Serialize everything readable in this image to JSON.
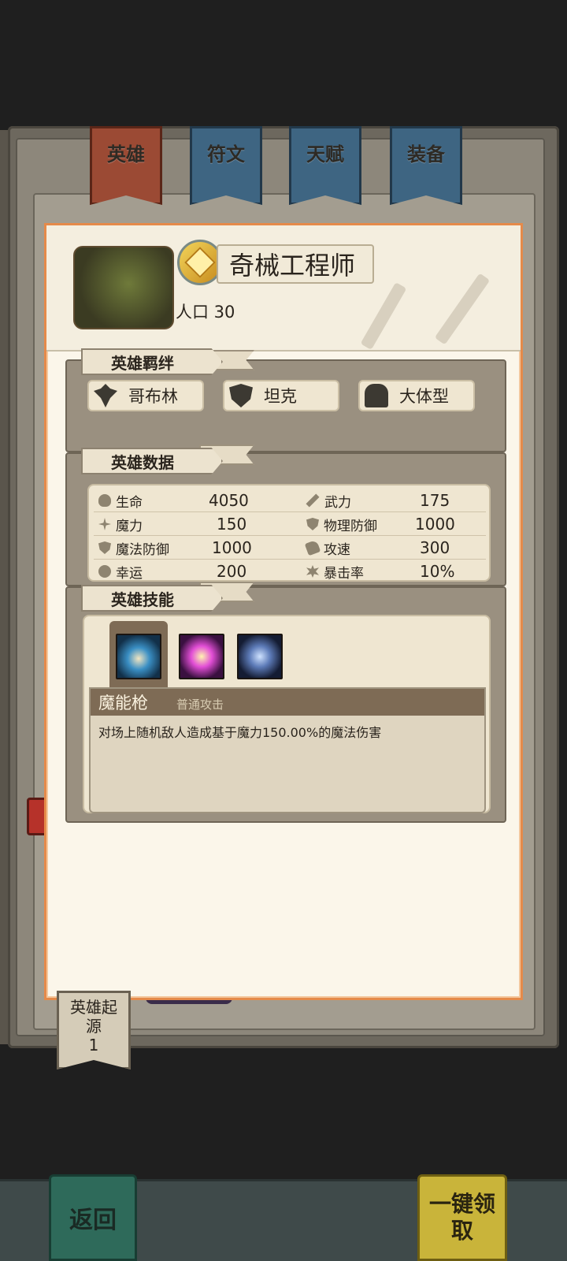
{
  "tabs": [
    {
      "label": "英雄",
      "active": true
    },
    {
      "label": "符文",
      "active": false
    },
    {
      "label": "天赋",
      "active": false
    },
    {
      "label": "装备",
      "active": false
    }
  ],
  "hero": {
    "name": "奇械工程师",
    "population": "人口 30"
  },
  "sections": {
    "bonds_title": "英雄羁绊",
    "stats_title": "英雄数据",
    "skills_title": "英雄技能"
  },
  "bonds": [
    {
      "label": "哥布林",
      "icon": "goblin-icon"
    },
    {
      "label": "坦克",
      "icon": "shield-icon"
    },
    {
      "label": "大体型",
      "icon": "body-icon"
    }
  ],
  "stats": [
    {
      "label": "生命",
      "value": "4050",
      "icon": "heart-icon"
    },
    {
      "label": "武力",
      "value": "175",
      "icon": "sword-icon"
    },
    {
      "label": "魔力",
      "value": "150",
      "icon": "magic-icon"
    },
    {
      "label": "物理防御",
      "value": "1000",
      "icon": "shield-icon"
    },
    {
      "label": "魔法防御",
      "value": "1000",
      "icon": "magic-shield-icon"
    },
    {
      "label": "攻速",
      "value": "300",
      "icon": "boot-icon"
    },
    {
      "label": "幸运",
      "value": "200",
      "icon": "clover-icon"
    },
    {
      "label": "暴击率",
      "value": "10%",
      "icon": "burst-icon"
    }
  ],
  "skills": {
    "icons": [
      "magic-gun-skill-icon",
      "explosion-skill-icon",
      "orb-skill-icon"
    ],
    "selected_name": "魔能枪",
    "selected_type": "普通攻击",
    "selected_desc": "对场上随机敌人造成基于魔力150.00%的魔法伤害"
  },
  "bookmark": {
    "line1": "英雄起",
    "line2": "源",
    "line3": "1"
  },
  "bottom": {
    "back_label": "返回",
    "claim_label": "一键领取"
  }
}
